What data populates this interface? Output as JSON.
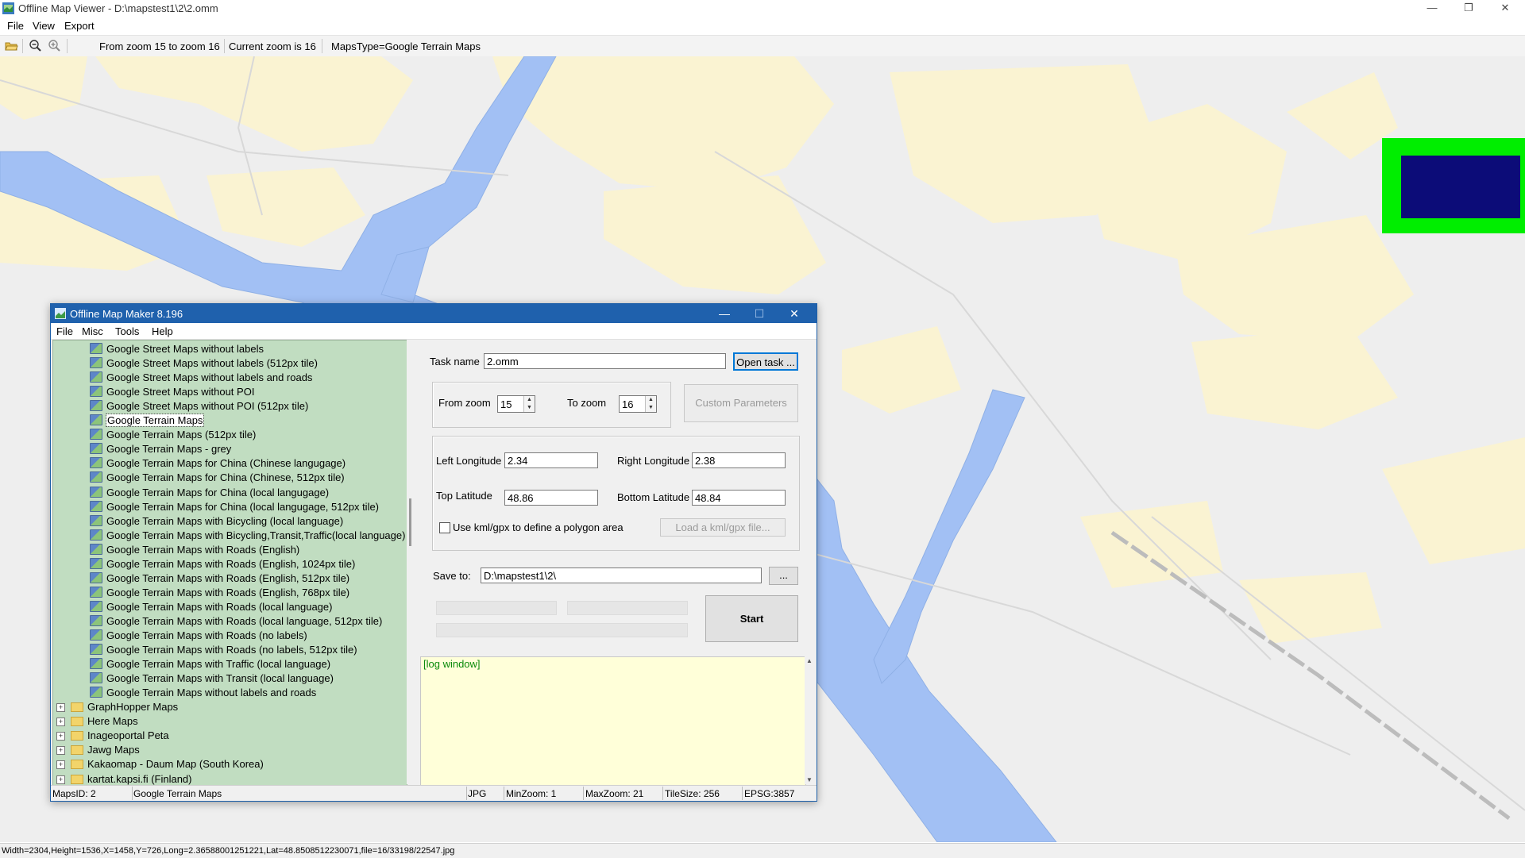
{
  "window": {
    "title": "Offline Map Viewer - D:\\mapstest1\\2\\2.omm",
    "controls": {
      "minimize": "—",
      "restore": "❐",
      "close": "✕"
    }
  },
  "menu": [
    "File",
    "View",
    "Export"
  ],
  "toolbar": {
    "zoom_range": "From zoom 15 to zoom 16",
    "current_zoom": "Current zoom is 16",
    "maps_type": "MapsType=Google Terrain Maps",
    "icons": [
      "open-folder-icon",
      "zoom-out-icon",
      "zoom-in-icon"
    ]
  },
  "status_line": "Width=2304,Height=1536,X=1458,Y=726,Long=2.36588001251221,Lat=48.8508512230071,file=16/33198/22547.jpg",
  "colors": {
    "water": "#a2c0f4",
    "urban": "#faf3d2",
    "land": "#eeeeee",
    "tree_bg": "#c1ddc1",
    "log_bg": "#ffffd9",
    "dialog_title": "#1f61ad",
    "overview_frame": "#00ee00",
    "overview_inner": "#0c0c78"
  },
  "dialog": {
    "title": "Offline Map Maker 8.196",
    "controls": {
      "minimize": "—",
      "maximize": "☐",
      "close": "✕"
    },
    "menu": [
      "File",
      "Misc",
      "Tools",
      "Help"
    ],
    "tree": {
      "map_items": [
        "Google Street Maps without labels",
        "Google Street Maps without labels (512px tile)",
        "Google Street Maps without labels and roads",
        "Google Street Maps without POI",
        "Google Street Maps without POI (512px tile)",
        "Google Terrain Maps",
        "Google Terrain Maps (512px tile)",
        "Google Terrain Maps - grey",
        "Google Terrain Maps for China (Chinese langugage)",
        "Google Terrain Maps for China (Chinese, 512px tile)",
        "Google Terrain Maps for China (local langugage)",
        "Google Terrain Maps for China (local langugage, 512px tile)",
        "Google Terrain Maps with Bicycling (local language)",
        "Google Terrain Maps with Bicycling,Transit,Traffic(local language)",
        "Google Terrain Maps with Roads (English)",
        "Google Terrain Maps with Roads (English, 1024px tile)",
        "Google Terrain Maps with Roads (English, 512px tile)",
        "Google Terrain Maps with Roads (English, 768px tile)",
        "Google Terrain Maps with Roads (local language)",
        "Google Terrain Maps with Roads (local language, 512px tile)",
        "Google Terrain Maps with Roads (no labels)",
        "Google Terrain Maps with Roads (no labels, 512px tile)",
        "Google Terrain Maps with Traffic (local language)",
        "Google Terrain Maps with Transit (local language)",
        "Google Terrain Maps without labels and roads"
      ],
      "selected_index": 5,
      "folders": [
        "GraphHopper Maps",
        "Here Maps",
        "Inageoportal Peta",
        "Jawg Maps",
        "Kakaomap - Daum Map (South Korea)",
        "kartat.kapsi.fi (Finland)"
      ]
    },
    "form": {
      "task_name_label": "Task name",
      "task_name_value": "2.omm",
      "open_task_button": "Open task ...",
      "from_zoom_label": "From zoom",
      "from_zoom_value": "15",
      "to_zoom_label": "To zoom",
      "to_zoom_value": "16",
      "custom_params_button": "Custom Parameters",
      "left_lon_label": "Left Longitude",
      "left_lon_value": "2.34",
      "right_lon_label": "Right Longitude",
      "right_lon_value": "2.38",
      "top_lat_label": "Top Latitude",
      "top_lat_value": "48.86",
      "bottom_lat_label": "Bottom Latitude",
      "bottom_lat_value": "48.84",
      "use_kml_label": "Use kml/gpx to define a polygon area",
      "load_kml_button": "Load a kml/gpx file...",
      "save_to_label": "Save to:",
      "save_to_value": "D:\\mapstest1\\2\\",
      "browse_button": "...",
      "start_button": "Start",
      "log_text": "[log window]"
    },
    "status": {
      "maps_id": "MapsID: 2",
      "maps_name": "Google Terrain Maps",
      "format": "JPG",
      "min_zoom": "MinZoom: 1",
      "max_zoom": "MaxZoom: 21",
      "tile_size": "TileSize: 256",
      "epsg": "EPSG:3857"
    }
  }
}
